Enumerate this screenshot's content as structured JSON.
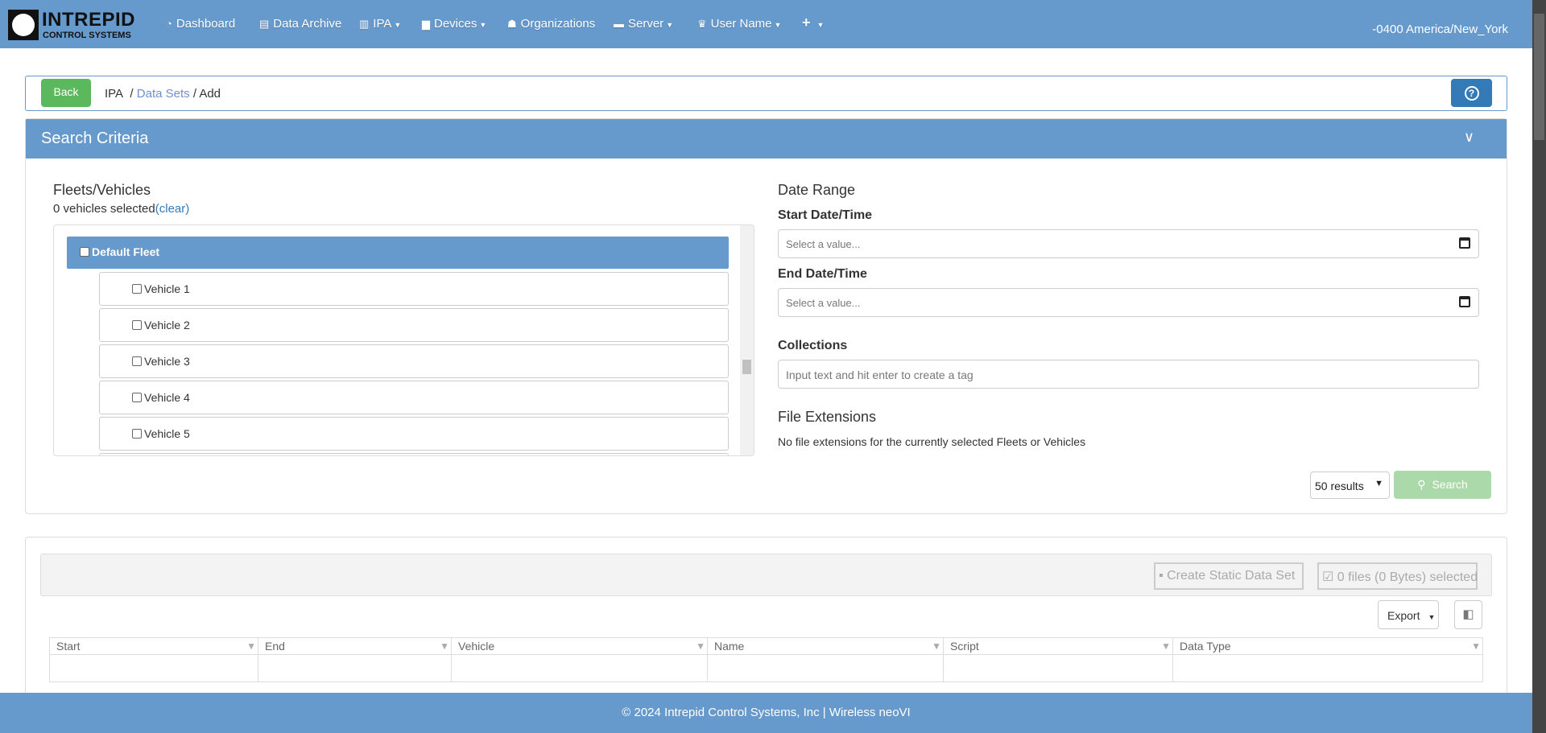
{
  "brand": {
    "line1": "INTREPID",
    "line2": "CONTROL SYSTEMS"
  },
  "nav": [
    {
      "label": "Dashboard",
      "icon": "dashboard-icon"
    },
    {
      "label": "Data Archive",
      "icon": "file-search-icon"
    },
    {
      "label": "IPA",
      "icon": "beer-mug-icon",
      "dropdown": true
    },
    {
      "label": "Devices",
      "icon": "device-icon",
      "dropdown": true
    },
    {
      "label": "Organizations",
      "icon": "sitemap-icon"
    },
    {
      "label": "Server",
      "icon": "server-icon",
      "dropdown": true
    },
    {
      "label": "User Name",
      "icon": "crown-icon",
      "dropdown": true
    },
    {
      "label": "+",
      "icon": "plus-icon",
      "dropdown": true
    }
  ],
  "timezone": "-0400 America/New_York",
  "breadcrumb": {
    "back": "Back",
    "root": "IPA",
    "sep": "/",
    "link": "Data Sets",
    "current": "Add"
  },
  "search": {
    "title": "Search Criteria",
    "fleets_title": "Fleets/Vehicles",
    "selected": "0 vehicles selected",
    "clear": "(clear)",
    "fleet": "Default Fleet",
    "vehicles": [
      "Vehicle 1",
      "Vehicle 2",
      "Vehicle 3",
      "Vehicle 4",
      "Vehicle 5"
    ],
    "date_range": "Date Range",
    "start_label": "Start Date/Time",
    "end_label": "End Date/Time",
    "date_placeholder": "Select a value...",
    "collections_label": "Collections",
    "collections_placeholder": "Input text and hit enter to create a tag",
    "ext_title": "File Extensions",
    "ext_msg": "No file extensions for the currently selected Fleets or Vehicles",
    "results": "50 results",
    "search_btn": "Search"
  },
  "results": {
    "create": "Create Static Data Set",
    "selected": "0 files (0 Bytes) selected",
    "export": "Export",
    "columns": [
      "Start",
      "End",
      "Vehicle",
      "Name",
      "Script",
      "Data Type"
    ]
  },
  "footer": "© 2024 Intrepid Control Systems, Inc | Wireless neoVI",
  "colors": {
    "nav": "#6699cc",
    "success": "#5cb85c",
    "primary": "#337ab7"
  }
}
